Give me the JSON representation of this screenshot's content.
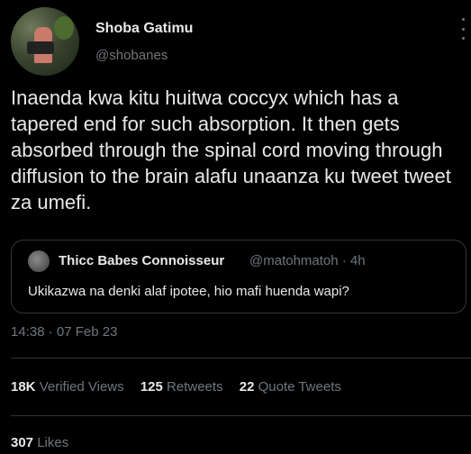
{
  "author": {
    "name": "Shoba Gatimu",
    "handle": "@shobanes"
  },
  "tweet_text": "Inaenda kwa kitu huitwa coccyx which has a tapered end for such absorption. It then gets absorbed through the spinal cord moving through diffusion to the brain alafu unaanza ku tweet tweet za umefi.",
  "quoted": {
    "name": "Thicc Babes Connoisseur",
    "handle_time": "@matohmatoh · 4h",
    "text": "Ukikazwa na denki alaf ipotee, hio mafi huenda wapi?"
  },
  "timestamp": "14:38 · 07 Feb 23",
  "stats": {
    "views_count": "18K",
    "views_label": "Verified Views",
    "retweets_count": "125",
    "retweets_label": "Retweets",
    "quotes_count": "22",
    "quotes_label": "Quote Tweets",
    "likes_count": "307",
    "likes_label": "Likes"
  }
}
